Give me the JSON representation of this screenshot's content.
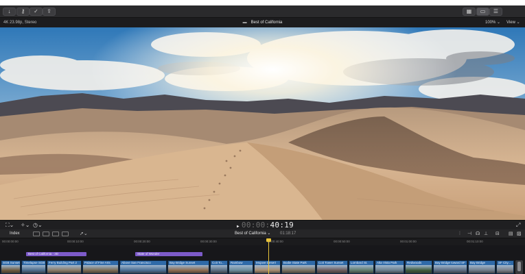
{
  "toolbar": {
    "left_buttons": [
      {
        "name": "import-button",
        "icon": "download-arrow-icon",
        "glyph": "↓"
      },
      {
        "name": "keywords-button",
        "icon": "key-icon",
        "glyph": "⚷"
      },
      {
        "name": "background-tasks-button",
        "icon": "checkmark-circle-icon",
        "glyph": "✓"
      },
      {
        "name": "share-button",
        "icon": "share-icon",
        "glyph": "⇪"
      }
    ],
    "right_buttons": [
      {
        "name": "browser-toggle-button",
        "icon": "grid-icon",
        "glyph": "▦"
      },
      {
        "name": "timeline-toggle-button",
        "icon": "timeline-icon",
        "glyph": "▭"
      },
      {
        "name": "inspector-toggle-button",
        "icon": "sliders-icon",
        "glyph": "☰"
      }
    ]
  },
  "viewer": {
    "format": "4K 23.98p, Stereo",
    "project_title": "Best of California",
    "zoom": "100%",
    "view_menu": "View"
  },
  "transport": {
    "timecode_dim": "00:00:",
    "timecode_bright": "40:19"
  },
  "timeline": {
    "index_label": "Index",
    "project_name": "Best of California",
    "duration": "01:18:17",
    "ruler_labels": [
      "00:00:00:00",
      "00:00:10:00",
      "00:00:20:00",
      "00:00:30:00",
      "00:00:40:00",
      "00:00:50:00",
      "00:01:00:00",
      "00:01:10:00"
    ],
    "title_clips": [
      {
        "label": "Best of California - 3D"
      },
      {
        "label": "State of Wonder"
      }
    ],
    "clips": [
      "SGB Sunset",
      "Timelapse SGB",
      "Ferry Building Part 2",
      "Palace of Fine Arts",
      "Above San Francisco",
      "Bay Bridge Sunset",
      "Coit To...",
      "Rainbow",
      "Mojave Desert",
      "Bodie State Park",
      "Coit Tower Sunset",
      "Lombard St.",
      "Alta Vista Park",
      "Redwoods",
      "Bay Bridge toward SF",
      "Bay Bridge",
      "SF City..."
    ]
  }
}
